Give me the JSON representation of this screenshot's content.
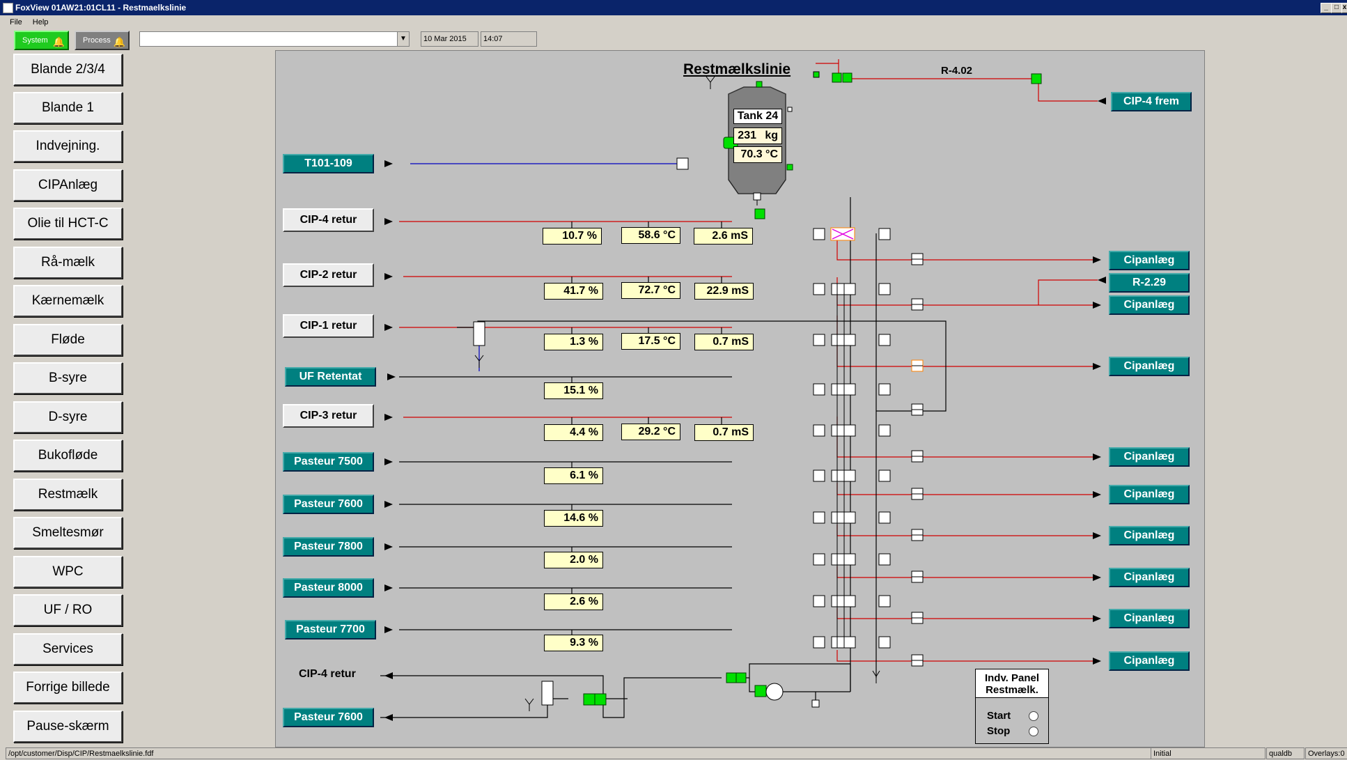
{
  "window": {
    "title": "FoxView 01AW21:01CL11  - Restmaelkslinie",
    "min": "_",
    "max": "□",
    "close": "x"
  },
  "menu": {
    "file": "File",
    "help": "Help"
  },
  "toolbar": {
    "system_label": "System",
    "process_label": "Process",
    "combo_value": "",
    "date": "10 Mar 2015",
    "time": "14:07"
  },
  "nav": {
    "items": [
      "Blande 2/3/4",
      "Blande 1",
      "Indvejning.",
      "CIPAnlæg",
      "Olie til HCT-C",
      "Rå-mælk",
      "Kærnemælk",
      "Fløde",
      "B-syre",
      "D-syre",
      "Bukofløde",
      "Restmælk",
      "Smeltesmør",
      "WPC",
      "UF / RO",
      "Services",
      "Forrige billede",
      "Pause-skærm"
    ]
  },
  "panel": {
    "title": "Restmælkslinie",
    "r402": "R-4.02",
    "tank": {
      "name": "Tank 24",
      "mass": "231",
      "mass_unit": "kg",
      "temp": "70.3 °C"
    },
    "left_buttons": [
      "T101-109",
      "CIP-4 retur",
      "CIP-2 retur",
      "CIP-1 retur",
      "UF Retentat",
      "CIP-3 retur",
      "Pasteur 7500",
      "Pasteur 7600",
      "Pasteur 7800",
      "Pasteur 8000",
      "Pasteur 7700"
    ],
    "bottom_left": {
      "cip4_return": "CIP-4 retur",
      "pasteur_7600": "Pasteur 7600"
    },
    "readings": {
      "cip4": [
        "10.7 %",
        "58.6 °C",
        "2.6 mS"
      ],
      "cip2": [
        "41.7 %",
        "72.7 °C",
        "22.9 mS"
      ],
      "cip1": [
        "1.3 %",
        "17.5 °C",
        "0.7 mS"
      ],
      "uf": [
        "15.1 %"
      ],
      "cip3": [
        "4.4 %",
        "29.2 °C",
        "0.7 mS"
      ],
      "p7500": [
        "6.1 %"
      ],
      "p7600": [
        "14.6 %"
      ],
      "p7800": [
        "2.0 %"
      ],
      "p8000": [
        "2.6 %"
      ],
      "p7700": [
        "9.3 %"
      ]
    },
    "right_buttons": [
      "CIP-4 frem",
      "Cipanlæg",
      "R-2.29",
      "Cipanlæg",
      "Cipanlæg",
      "Cipanlæg",
      "Cipanlæg",
      "Cipanlæg",
      "Cipanlæg",
      "Cipanlæg",
      "Cipanlæg"
    ],
    "indv_panel": {
      "title": "Indv. Panel Restmælk.",
      "start": "Start",
      "stop": "Stop"
    }
  },
  "status": {
    "path": "/opt/customer/Disp/CIP/Restmaelkslinie.fdf",
    "state": "Initial",
    "db": "qualdb",
    "overlays": "Overlays:0"
  },
  "colors": {
    "teal": "#008080",
    "green": "#00e000",
    "red_line": "#d00000",
    "blue_line": "#0000c0",
    "value_bg": "#ffffc8"
  }
}
